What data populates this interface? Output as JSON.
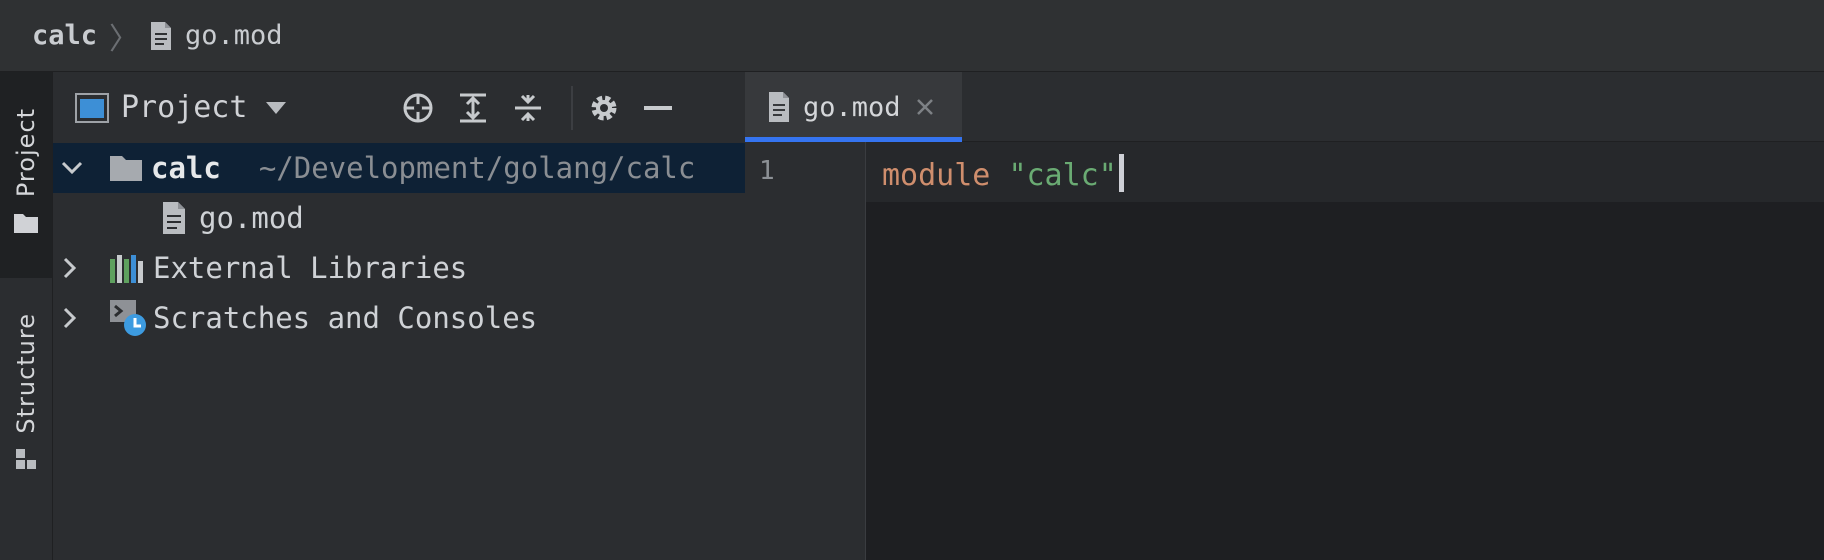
{
  "breadcrumb": {
    "root": "calc",
    "separator": "〉",
    "file": "go.mod"
  },
  "tool_stripe": {
    "project_label": "Project",
    "structure_label": "Structure"
  },
  "project_panel": {
    "title": "Project",
    "tree": [
      {
        "label": "calc",
        "path": "~/Development/golang/calc",
        "expanded": true,
        "icon": "folder-icon"
      },
      {
        "label": "go.mod",
        "icon": "file-icon"
      },
      {
        "label": "External Libraries",
        "expanded": false,
        "icon": "libraries-icon"
      },
      {
        "label": "Scratches and Consoles",
        "expanded": false,
        "icon": "scratches-icon"
      }
    ]
  },
  "editor": {
    "tab_label": "go.mod",
    "line_number": "1",
    "code_keyword": "module",
    "code_string": "\"calc\""
  },
  "colors": {
    "accent": "#3574f0",
    "keyword": "#cf8e6d",
    "string": "#6aab73",
    "selection": "#0e2135"
  }
}
